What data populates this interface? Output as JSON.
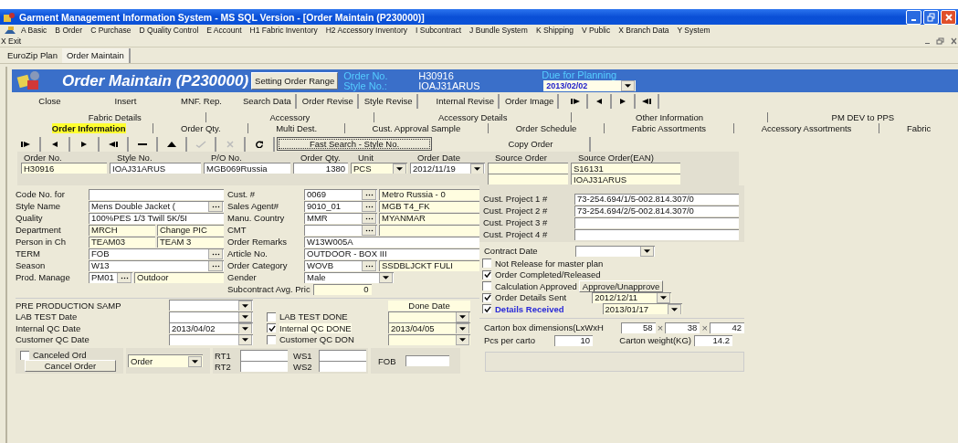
{
  "window": {
    "title": "Garment Management Information System - MS SQL Version - [Order Maintain (P230000)]"
  },
  "menu": [
    "A Basic",
    "B Order",
    "C Purchase",
    "D Quality Control",
    "E Account",
    "H1 Fabric Inventory",
    "H2 Accessory Inventory",
    "I Subcontract",
    "J Bundle System",
    "K Shipping",
    "V Public",
    "X Branch Data",
    "Y System"
  ],
  "exit_menu": "X Exit",
  "doc_tabs": [
    {
      "label": "EuroZip Plan",
      "selected": false
    },
    {
      "label": "Order Maintain",
      "selected": true
    }
  ],
  "header": {
    "title": "Order Maintain (P230000)",
    "range_button": "Setting Order Range",
    "order_no_label": "Order No.",
    "order_no": "H30916",
    "style_no_label": "Style No.:",
    "style_no": "IOAJ31ARUS",
    "due_label": "Due for Planning",
    "due_date": "2013/02/02"
  },
  "actions": [
    {
      "label": "Close",
      "kind": "flat"
    },
    {
      "label": "Insert",
      "kind": "flat"
    },
    {
      "label": "MNF. Rep.",
      "kind": "flat"
    },
    {
      "label": "Search Data",
      "kind": "raised"
    },
    {
      "label": "Order Revise",
      "kind": "raised"
    },
    {
      "label": "Style Revise",
      "kind": "raised"
    },
    {
      "label": "Internal Revise",
      "kind": "raised"
    },
    {
      "label": "Order Image",
      "kind": "raised"
    }
  ],
  "action_nav": [
    {
      "kind": "first"
    },
    {
      "kind": "prev"
    },
    {
      "kind": "next"
    },
    {
      "kind": "last"
    }
  ],
  "tab_rows": [
    {
      "tabs": [
        {
          "label": "Fabric Details",
          "selected": false
        },
        {
          "label": "Accessory",
          "selected": false
        },
        {
          "label": "Accessory Details",
          "selected": false
        },
        {
          "label": "Other Information",
          "selected": false
        },
        {
          "label": "PM DEV to PPS",
          "selected": false
        }
      ]
    },
    {
      "tabs": [
        {
          "label": "Order Information",
          "selected": true
        },
        {
          "label": "Order Qty.",
          "selected": false
        },
        {
          "label": "Multi Dest.",
          "selected": false
        },
        {
          "label": "Cust. Approval Sample",
          "selected": false
        },
        {
          "label": "Order Schedule",
          "selected": false
        },
        {
          "label": "Fabric Assortments",
          "selected": false
        },
        {
          "label": "Accessory Assortments",
          "selected": false
        },
        {
          "label": "Fabric",
          "selected": false
        }
      ]
    }
  ],
  "record_tools": [
    {
      "kind": "first",
      "disabled": false
    },
    {
      "kind": "prev",
      "disabled": false
    },
    {
      "kind": "next",
      "disabled": false
    },
    {
      "kind": "last",
      "disabled": false
    },
    {
      "kind": "remove",
      "disabled": false
    },
    {
      "kind": "up",
      "disabled": false
    },
    {
      "kind": "confirm",
      "disabled": true
    },
    {
      "kind": "cancel",
      "disabled": true
    },
    {
      "kind": "refresh",
      "disabled": false
    }
  ],
  "fast_search": "Fast Search - Style No.",
  "copy_order": "Copy Order",
  "order_strip": [
    {
      "label": "Order No.",
      "inputs": [
        {
          "kind": "text",
          "value": "H30916",
          "readonly": true
        }
      ]
    },
    {
      "label": "Style No.",
      "inputs": [
        {
          "kind": "text",
          "value": "IOAJ31ARUS",
          "readonly": false
        }
      ]
    },
    {
      "label": "P/O No.",
      "inputs": [
        {
          "kind": "text",
          "value": "MGB069Russia",
          "readonly": false
        }
      ]
    },
    {
      "label": "Order Qty.",
      "inputs": [
        {
          "kind": "number",
          "value": "1380",
          "readonly": false
        }
      ]
    },
    {
      "label": "Unit",
      "inputs": [
        {
          "kind": "select",
          "value": "PCS",
          "readonly": true
        }
      ]
    },
    {
      "label": "Order Date",
      "inputs": [
        {
          "kind": "select",
          "value": "2012/11/19",
          "readonly": false
        }
      ]
    },
    {
      "label": "Source Order",
      "inputs": [
        {
          "kind": "text",
          "readonly": true
        },
        {
          "kind": "text",
          "readonly": true
        }
      ]
    },
    {
      "label": "Source Order(EAN)",
      "inputs": [
        {
          "kind": "text",
          "value": "S16131",
          "readonly": true
        },
        {
          "kind": "text",
          "value": "IOAJ31ARUS",
          "readonly": true
        }
      ]
    }
  ],
  "left_fields": [
    {
      "label": "Code No. for",
      "inputs": [
        {
          "kind": "text",
          "readonly": false
        }
      ]
    },
    {
      "label": "Style Name",
      "inputs": [
        {
          "kind": "lookup",
          "value": "Mens Double Jacket (",
          "readonly": false
        }
      ]
    },
    {
      "label": "Quality",
      "inputs": [
        {
          "kind": "text",
          "value": "100%PES 1/3 Twill 5K/5I",
          "readonly": false
        }
      ]
    },
    {
      "label": "Department",
      "inputs": [
        {
          "kind": "text",
          "value": "MRCH",
          "readonly": true
        },
        {
          "kind": "text",
          "value": "Change PIC",
          "readonly": true
        }
      ]
    },
    {
      "label": "Person in Ch",
      "inputs": [
        {
          "kind": "text",
          "value": "TEAM03",
          "readonly": true
        },
        {
          "kind": "text",
          "value": "TEAM 3",
          "readonly": true
        }
      ]
    },
    {
      "label": "TERM",
      "inputs": [
        {
          "kind": "lookup",
          "value": "FOB",
          "readonly": false
        }
      ]
    },
    {
      "label": "Season",
      "inputs": [
        {
          "kind": "lookup",
          "value": "W13",
          "readonly": false
        }
      ]
    },
    {
      "label": "Prod. Manage",
      "inputs": [
        {
          "kind": "lookup",
          "value": "PM01",
          "readonly": false
        },
        {
          "kind": "text",
          "value": "Outdoor",
          "readonly": true
        }
      ]
    }
  ],
  "middle_fields": [
    {
      "label": "Cust. #",
      "inputs": [
        {
          "kind": "lookup",
          "value": "0069",
          "readonly": false
        },
        {
          "kind": "text",
          "value": "Metro Russia - 0",
          "readonly": true
        }
      ]
    },
    {
      "label": "Sales Agent#",
      "inputs": [
        {
          "kind": "lookup",
          "value": "9010_01",
          "readonly": false
        },
        {
          "kind": "text",
          "value": "MGB T4_FK",
          "readonly": true
        }
      ]
    },
    {
      "label": "Manu. Country",
      "inputs": [
        {
          "kind": "lookup",
          "value": "MMR",
          "readonly": false
        },
        {
          "kind": "text",
          "value": "MYANMAR",
          "readonly": true
        }
      ]
    },
    {
      "label": "CMT",
      "inputs": [
        {
          "kind": "lookup",
          "readonly": false
        },
        {
          "kind": "text",
          "readonly": true
        }
      ]
    },
    {
      "label": "Order Remarks",
      "inputs": [
        {
          "kind": "text",
          "value": "W13W005A",
          "readonly": false
        }
      ]
    },
    {
      "label": "Article No.",
      "inputs": [
        {
          "kind": "text",
          "value": "OUTDOOR - BOX III",
          "readonly": false
        }
      ]
    },
    {
      "label": "Order Category",
      "inputs": [
        {
          "kind": "lookup",
          "value": "WOVB",
          "readonly": false
        },
        {
          "kind": "text",
          "value": "SSDBLJCKT FULI",
          "readonly": true
        }
      ]
    },
    {
      "label": "Gender",
      "inputs": [
        {
          "kind": "select",
          "value": "Male",
          "readonly": false
        }
      ]
    },
    {
      "label": "Subcontract Avg. Pric",
      "inputs": [
        {
          "kind": "number",
          "value": "0",
          "readonly": true
        }
      ]
    }
  ],
  "projects": [
    {
      "label": "Cust. Project 1 #",
      "value": "73-254.694/1/5-002.814.307/0"
    },
    {
      "label": "Cust. Project 2 #",
      "value": "73-254.694/2/5-002.814.307/0"
    },
    {
      "label": "Cust. Project 3 #"
    },
    {
      "label": "Cust. Project 4 #"
    }
  ],
  "contract_date": {
    "label": "Contract Date"
  },
  "checks": [
    {
      "label": "Not Release for master plan",
      "checked": false,
      "emphasis": false
    },
    {
      "label": "Order Completed/Released",
      "checked": true,
      "emphasis": false
    },
    {
      "label": "Calculation Approved",
      "checked": false,
      "emphasis": false,
      "button": "Approve/Unapprove"
    },
    {
      "label": "Order Details Sent",
      "checked": true,
      "emphasis": false,
      "date": "2012/12/11"
    },
    {
      "label": "Details Received",
      "checked": true,
      "emphasis": true,
      "date": "2013/01/17"
    }
  ],
  "carton": {
    "label": "Carton box dimensions(LxWxH",
    "dims": [
      "58",
      "38",
      "42"
    ],
    "dim_seps": [
      "×",
      "×"
    ],
    "pcs_label": "Pcs per carto",
    "pcs": "10",
    "weight_label": "Carton weight(KG)",
    "weight": "14.2"
  },
  "qc_dates": [
    {
      "label": "PRE PRODUCTION SAMP"
    },
    {
      "label": "LAB TEST Date"
    },
    {
      "label": "Internal QC Date",
      "value": "2013/04/02"
    },
    {
      "label": "Customer QC Date"
    }
  ],
  "qc_done": {
    "header": "Done Date",
    "rows": [
      {
        "label": "LAB TEST DONE",
        "checked": false
      },
      {
        "label": "Internal QC DONE",
        "checked": true,
        "value": "2013/04/05"
      },
      {
        "label": "Customer QC DON",
        "checked": false
      }
    ]
  },
  "cancel": {
    "label": "Canceled Ord",
    "checked": false,
    "button": "Cancel Order"
  },
  "type_select": {
    "value": "Order"
  },
  "rates": [
    {
      "label": "RT1"
    },
    {
      "label": "RT2"
    },
    {
      "label": "WS1"
    },
    {
      "label": "WS2"
    }
  ],
  "fob": {
    "label": "FOB"
  }
}
